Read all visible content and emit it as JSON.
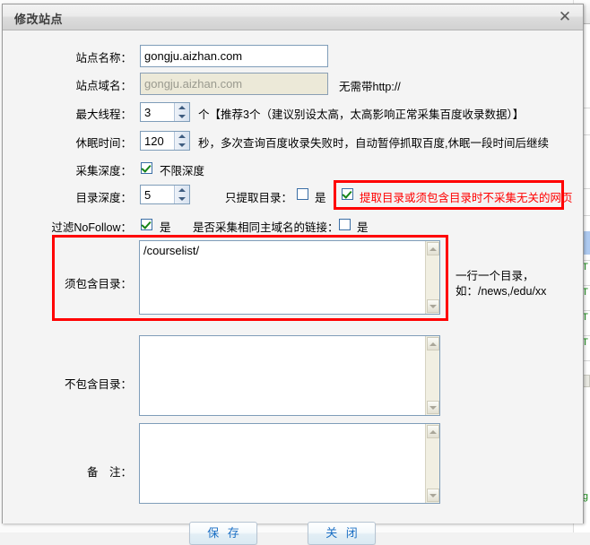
{
  "dialog": {
    "title": "修改站点",
    "close_icon": "close-icon"
  },
  "fields": {
    "site_name": {
      "label": "站点名称：",
      "value": "gongju.aizhan.com"
    },
    "site_domain": {
      "label": "站点域名：",
      "value": "gongju.aizhan.com",
      "note": "无需带http://"
    },
    "max_thread": {
      "label": "最大线程：",
      "value": "3",
      "note": "个【推荐3个（建议别设太高，太高影响正常采集百度收录数据）】"
    },
    "sleep_time": {
      "label": "休眠时间：",
      "value": "120",
      "note": "秒，多次查询百度收录失败时，自动暂停抓取百度,休眠一段时间后继续"
    },
    "collect_depth": {
      "label": "采集深度：",
      "checkbox_label": "不限深度",
      "checked": true
    },
    "dir_depth": {
      "label": "目录深度：",
      "value": "5",
      "only_extract_label": "只提取目录：",
      "only_extract_yes": "是",
      "only_extract_checked": false,
      "highlight_label": "提取目录或须包含目录时不采集无关的网页",
      "highlight_checked": true
    },
    "nofollow": {
      "label": "过滤NoFollow：",
      "yes": "是",
      "checked": true,
      "same_domain_label": "是否采集相同主域名的链接：",
      "same_domain_yes": "是",
      "same_domain_checked": false
    },
    "include_dirs": {
      "label": "须包含目录：",
      "value": "/courselist/",
      "hint_line1": "一行一个目录，",
      "hint_line2": "如：/news,/edu/xx"
    },
    "exclude_dirs": {
      "label": "不包含目录：",
      "value": ""
    },
    "remark": {
      "label": "备　注：",
      "value": ""
    }
  },
  "buttons": {
    "save": "保 存",
    "close": "关 闭"
  },
  "colors": {
    "highlight_red": "#ff0000",
    "button_text": "#1a6fc4",
    "input_border": "#7f9db9",
    "disabled_bg": "#ece9d8"
  }
}
